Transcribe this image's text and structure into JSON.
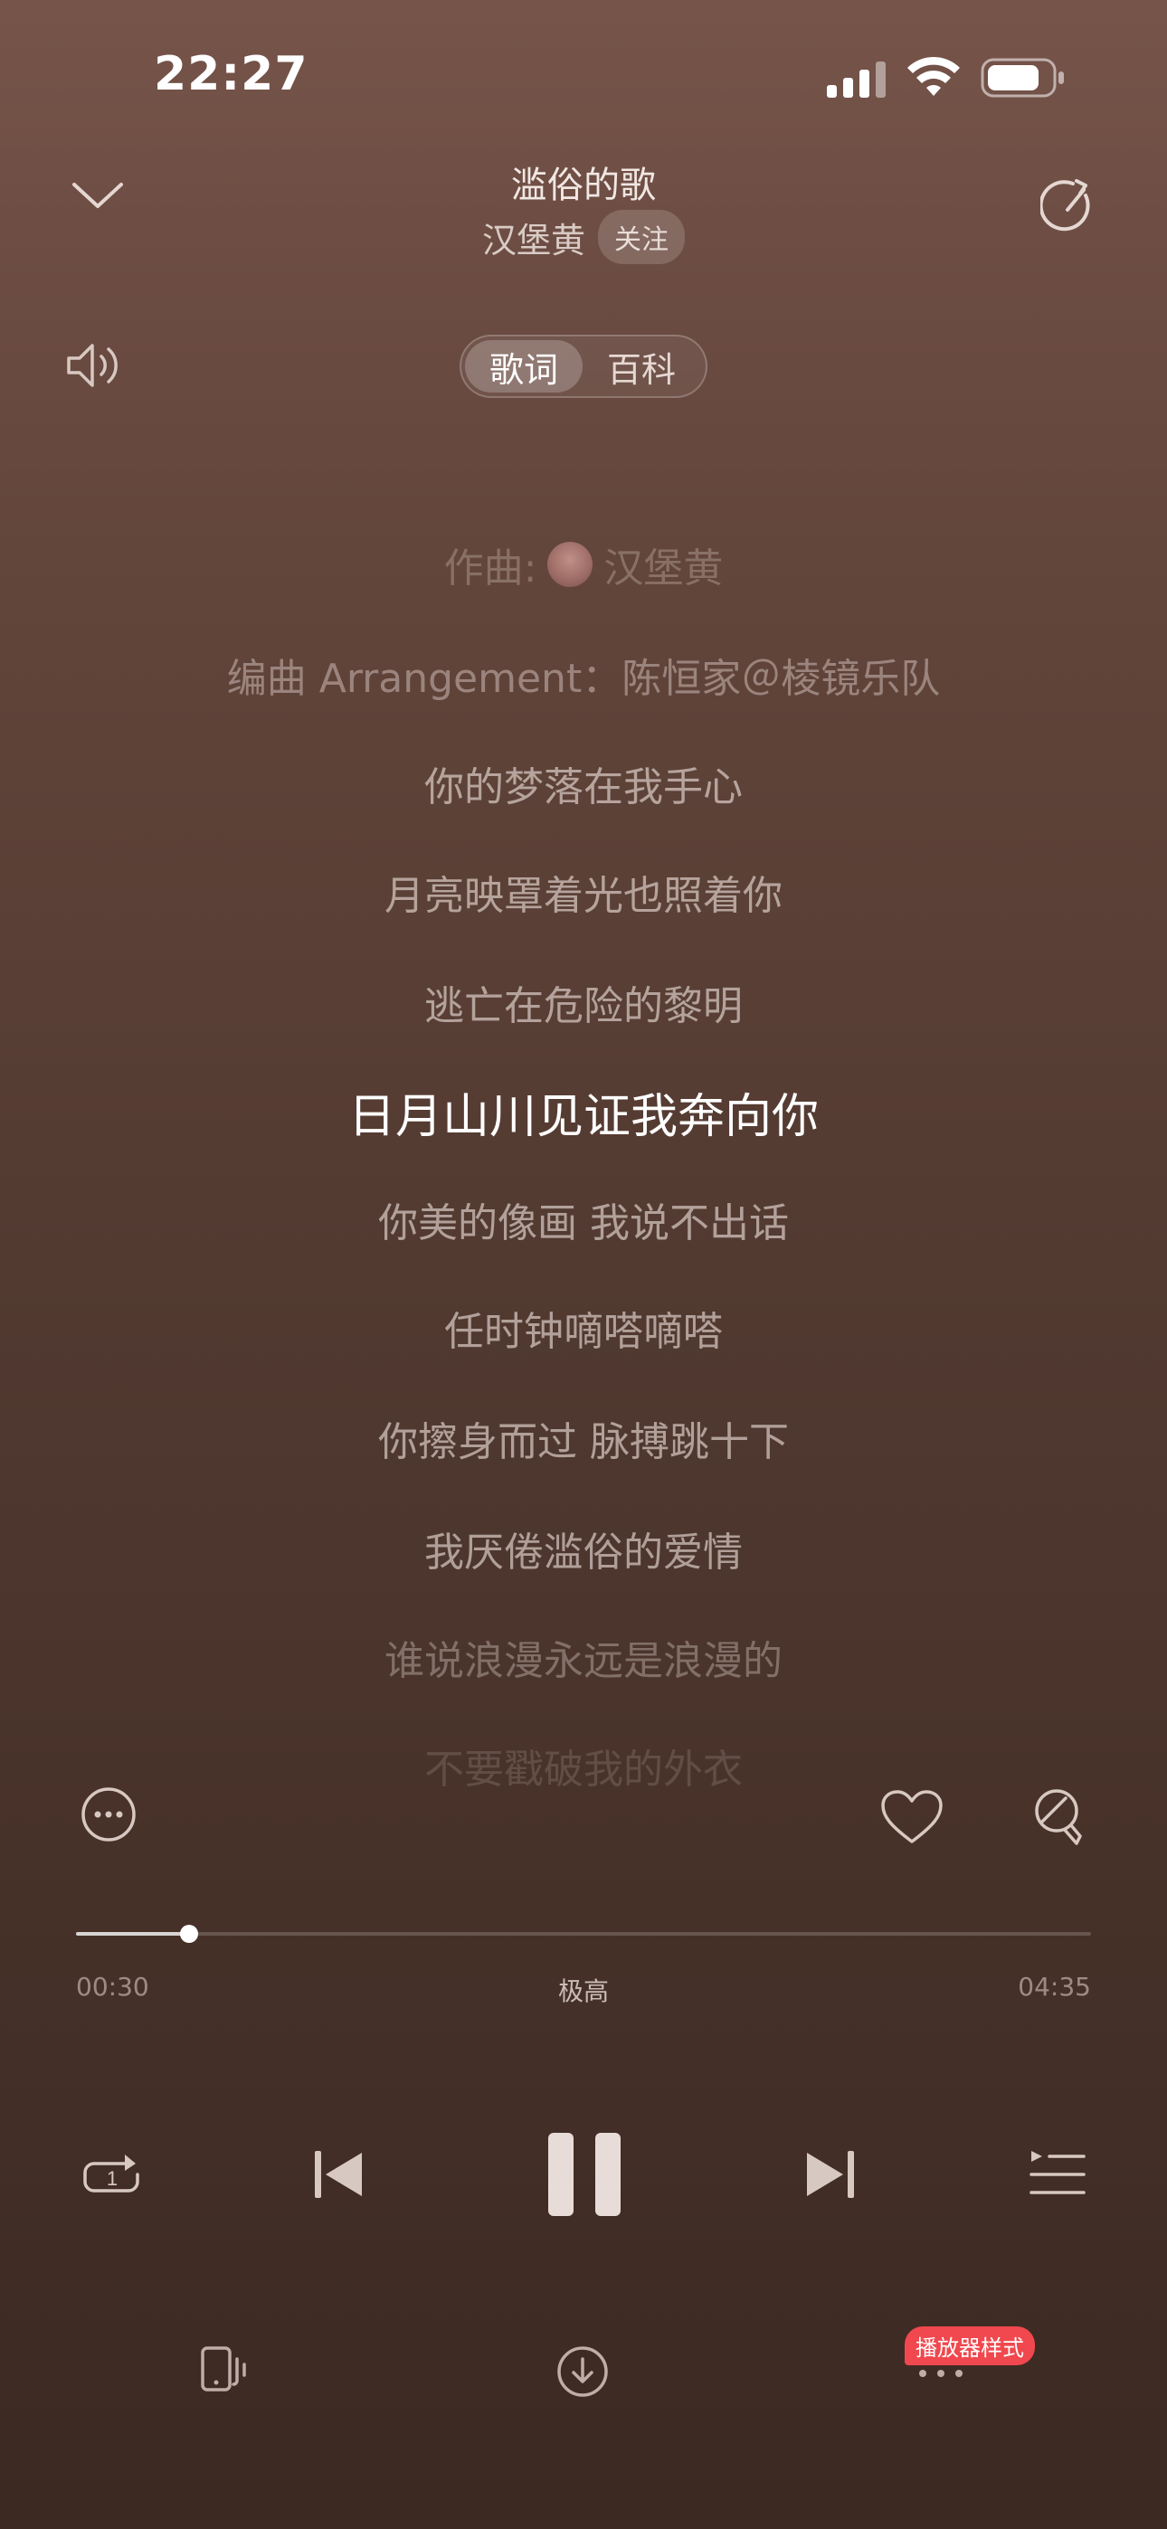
{
  "status_bar": {
    "time": "22:27"
  },
  "header": {
    "song_title": "滥俗的歌",
    "artist": "汉堡黄",
    "follow_label": "关注"
  },
  "tabs": [
    {
      "label": "歌词",
      "selected": true
    },
    {
      "label": "百科",
      "selected": false
    }
  ],
  "lyrics": {
    "composer_prefix": "作曲:",
    "composer_name": "汉堡黄",
    "arranger": "编曲 Arrangement：陈恒家＠棱镜乐队",
    "lines": [
      "你的梦落在我手心",
      "月亮映罩着光也照着你",
      "逃亡在危险的黎明",
      "日月山川见证我奔向你",
      "你美的像画 我说不出话",
      "任时钟嘀嗒嘀嗒",
      "你擦身而过 脉搏跳十下",
      "我厌倦滥俗的爱情",
      "谁说浪漫永远是浪漫的",
      "不要戳破我的外衣"
    ],
    "current_index": 3
  },
  "progress": {
    "current_time": "00:30",
    "total_time": "04:35",
    "fraction": 0.111,
    "quality": "极高"
  },
  "toolbar": {
    "player_style_badge": "播放器样式"
  },
  "icons": {
    "collapse": "chevron-down-icon",
    "share": "share-icon",
    "volume": "volume-icon",
    "more": "more-icon",
    "like": "heart-icon",
    "comment": "comment-icon",
    "repeat": "repeat-one-icon",
    "prev": "previous-icon",
    "pause": "pause-icon",
    "next": "next-icon",
    "playlist": "playlist-icon",
    "device": "device-icon",
    "download": "download-icon",
    "dots": "dots-icon"
  },
  "colors": {
    "accent_badge": "#f0484e",
    "bg_top": "#76544a",
    "bg_bottom": "#3b2922"
  }
}
